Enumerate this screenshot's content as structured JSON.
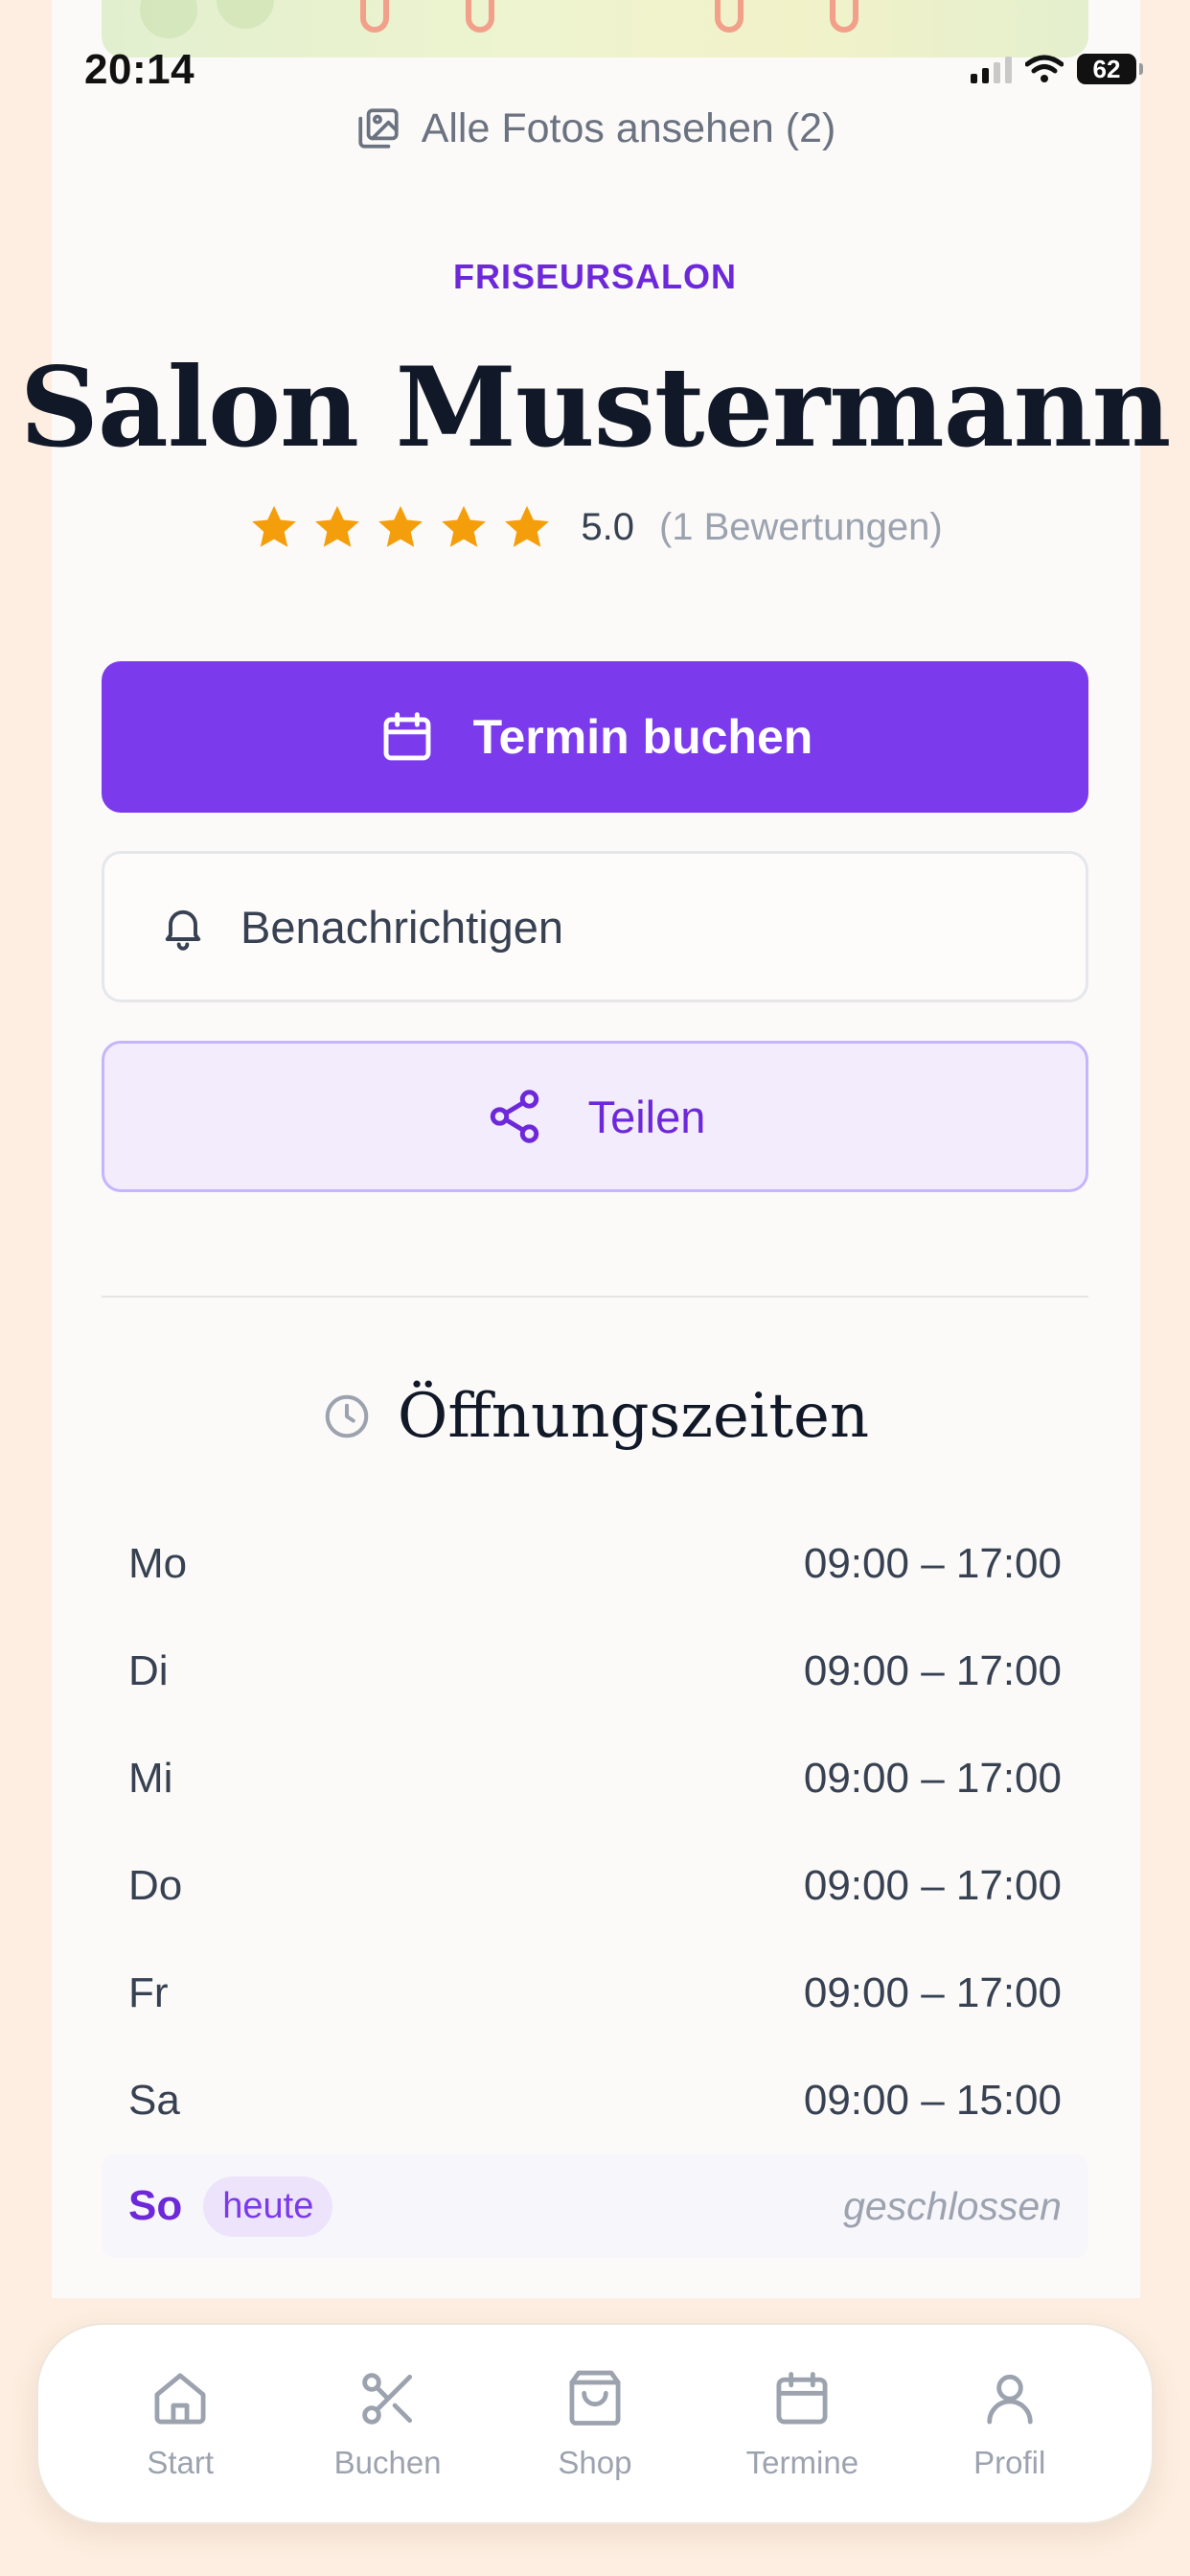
{
  "status_bar": {
    "time": "20:14",
    "battery": "62"
  },
  "gallery": {
    "link_label": "Alle Fotos ansehen (2)"
  },
  "salon": {
    "category": "FRISEURSALON",
    "name": "Salon Mustermann",
    "rating": {
      "value": "5.0",
      "count_label": "(1 Bewertungen)",
      "stars": 5
    }
  },
  "actions": {
    "book_label": "Termin buchen",
    "notify_label": "Benachrichtigen",
    "share_label": "Teilen"
  },
  "hours": {
    "title": "Öffnungszeiten",
    "days": [
      {
        "day": "Mo",
        "time": "09:00 – 17:00"
      },
      {
        "day": "Di",
        "time": "09:00 – 17:00"
      },
      {
        "day": "Mi",
        "time": "09:00 – 17:00"
      },
      {
        "day": "Do",
        "time": "09:00 – 17:00"
      },
      {
        "day": "Fr",
        "time": "09:00 – 17:00"
      },
      {
        "day": "Sa",
        "time": "09:00 – 15:00"
      },
      {
        "day": "So",
        "time": "geschlossen",
        "badge": "heute"
      }
    ]
  },
  "tabbar": {
    "items": [
      {
        "label": "Start",
        "icon": "home-icon"
      },
      {
        "label": "Buchen",
        "icon": "scissors-icon"
      },
      {
        "label": "Shop",
        "icon": "shopping-bag-icon"
      },
      {
        "label": "Termine",
        "icon": "calendar-icon"
      },
      {
        "label": "Profil",
        "icon": "user-icon"
      }
    ]
  },
  "colors": {
    "accent": "#7c3aed",
    "accent_dark": "#6d28d9",
    "star": "#f59e0b",
    "background": "#fdeee1"
  }
}
